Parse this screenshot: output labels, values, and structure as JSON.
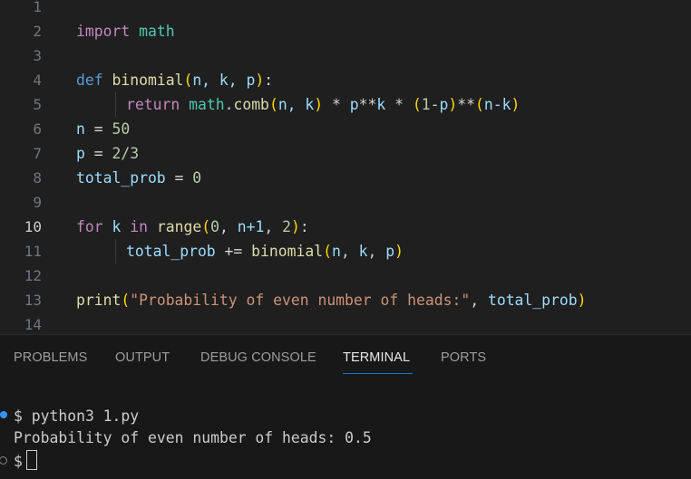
{
  "editor": {
    "line_numbers": [
      "1",
      "2",
      "3",
      "4",
      "5",
      "6",
      "7",
      "8",
      "9",
      "10",
      "11",
      "12",
      "13",
      "14"
    ],
    "active_line": "10",
    "lines": {
      "l2": {
        "import": "import",
        "module": "math"
      },
      "l4": {
        "def": "def",
        "name": "binomial",
        "open": "(",
        "params": "n, k, p",
        "close": ")",
        "colon": ":"
      },
      "l5": {
        "ret": "return",
        "math": "math",
        "dot": ".",
        "comb": "comb",
        "o1": "(",
        "args": "n, k",
        "c1": ")",
        "op1": " * ",
        "p": "p",
        "pow1": "**",
        "k": "k",
        "op2": " * ",
        "o2": "(",
        "one": "1",
        "minus": "-",
        "p2": "p",
        "c2": ")",
        "pow2": "**",
        "o3": "(",
        "nk": "n-k",
        "c3": ")"
      },
      "l6": {
        "var": "n",
        "eq": " = ",
        "val": "50"
      },
      "l7": {
        "var": "p",
        "eq": " = ",
        "val": "2/3"
      },
      "l8": {
        "var": "total_prob",
        "eq": " = ",
        "val": "0"
      },
      "l10": {
        "for": "for",
        "k": "k",
        "in": "in",
        "range": "range",
        "o": "(",
        "zero": "0",
        "c1": ", ",
        "n1": "n+1",
        "c2": ", ",
        "two": "2",
        "c": ")",
        "colon": ":"
      },
      "l11": {
        "var": "total_prob",
        "op": " += ",
        "fn": "binomial",
        "o": "(",
        "args": "n, k, p",
        "c": ")"
      },
      "l13": {
        "print": "print",
        "o": "(",
        "str": "\"Probability of even number of heads:\"",
        "comma": ", ",
        "var": "total_prob",
        "c": ")"
      }
    }
  },
  "panel": {
    "tabs": [
      "PROBLEMS",
      "OUTPUT",
      "DEBUG CONSOLE",
      "TERMINAL",
      "PORTS"
    ],
    "active_tab": "TERMINAL",
    "terminal": {
      "line1": "$ python3 1.py",
      "line2": "Probability of even number of heads: 0.5",
      "prompt": "$"
    }
  },
  "colors": {
    "accent": "#0078d4",
    "background": "#1f1f1f"
  }
}
